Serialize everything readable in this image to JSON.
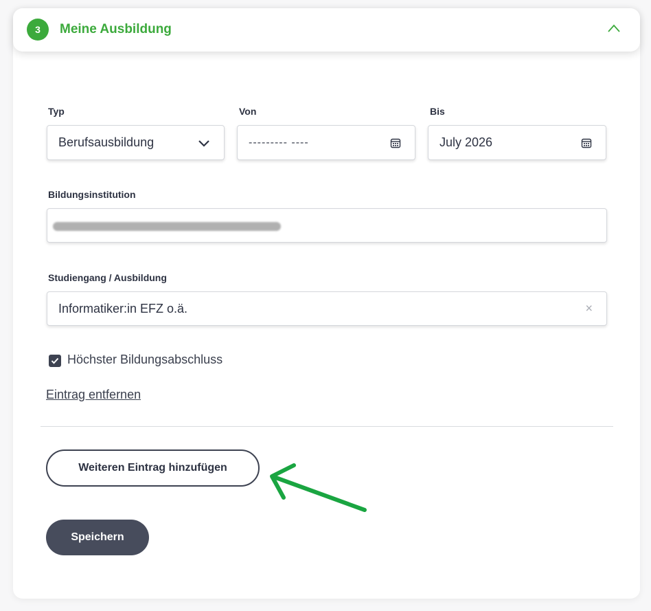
{
  "section": {
    "step_number": "3",
    "title": "Meine Ausbildung",
    "icon": "chevron-up-icon",
    "accent_color": "#3caa3c"
  },
  "form": {
    "typ": {
      "label": "Typ",
      "value": "Berufsausbildung"
    },
    "von": {
      "label": "Von",
      "value": "--------- ----"
    },
    "bis": {
      "label": "Bis",
      "value": "July 2026"
    },
    "institution": {
      "label": "Bildungsinstitution",
      "value_redacted": true
    },
    "studiengang": {
      "label": "Studiengang / Ausbildung",
      "value": "Informatiker:in EFZ o.ä.",
      "clear_label": "×"
    },
    "hoechster": {
      "label": "Höchster Bildungsabschluss",
      "checked": true
    },
    "remove_link": "Eintrag entfernen"
  },
  "actions": {
    "add_entry": "Weiteren Eintrag hinzufügen",
    "save": "Speichern"
  },
  "annotation": {
    "color": "#1aa541"
  }
}
